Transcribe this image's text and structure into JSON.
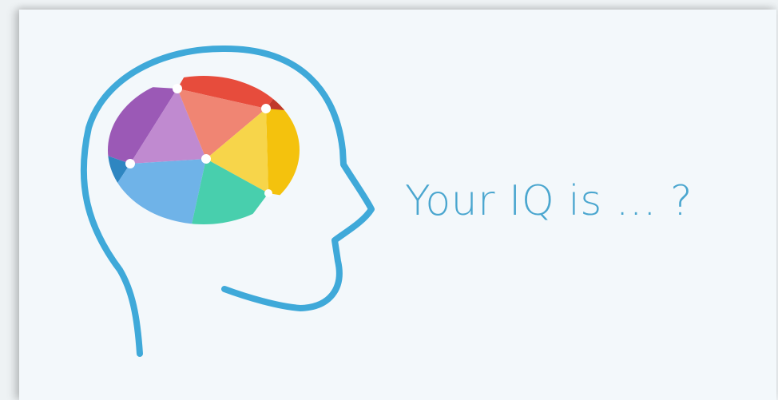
{
  "headline": {
    "text": "Your IQ is ... ?",
    "color": "#4aa6cf"
  },
  "illustration": {
    "icon": "head-with-brain-icon",
    "outline_color": "#3fa9d9",
    "brain_colors": [
      "#9b59b6",
      "#c08ad0",
      "#e74c3c",
      "#f08573",
      "#f4c20d",
      "#f7d54a",
      "#2e86c1",
      "#6fb3e8",
      "#48cfad",
      "#1abc9c"
    ],
    "node_color": "#ffffff"
  },
  "card": {
    "background": "#f3f8fb"
  }
}
